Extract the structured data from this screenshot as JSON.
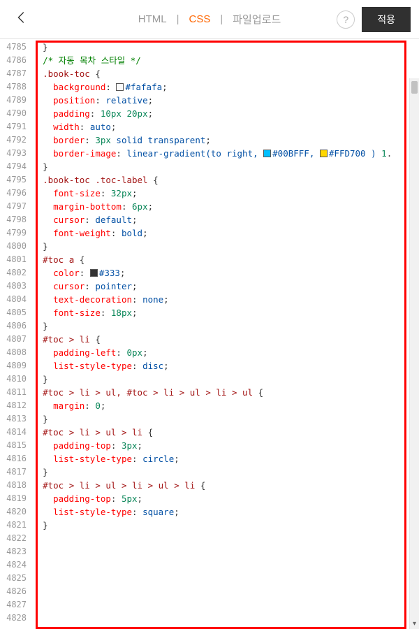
{
  "header": {
    "tabs": {
      "html": "HTML",
      "css": "CSS",
      "upload": "파일업로드"
    },
    "help": "?",
    "apply": "적용"
  },
  "gutterStart": 4785,
  "gutterEnd": 4828,
  "swatches": {
    "fafafa": "#fafafa",
    "c00bfff": "#00BFFF",
    "cffd700": "#FFD700",
    "c333": "#333333"
  },
  "lines": [
    {
      "t": "raw",
      "txt": "  }"
    },
    {
      "t": "raw",
      "txt": ""
    },
    {
      "t": "comment",
      "pre": "  ",
      "txt": "/* 자동 목차 스타일 */"
    },
    {
      "t": "selopen",
      "pre": "  ",
      "sel": ".book-toc"
    },
    {
      "t": "decl",
      "pre": "    ",
      "prop": "background",
      "valParts": [
        {
          "sw": "fafafa"
        },
        {
          "txt": "#fafafa"
        }
      ]
    },
    {
      "t": "decl",
      "pre": "    ",
      "prop": "position",
      "valParts": [
        {
          "txt": "relative"
        }
      ]
    },
    {
      "t": "decl",
      "pre": "    ",
      "prop": "padding",
      "valParts": [
        {
          "num": "10px"
        },
        {
          "txt": " "
        },
        {
          "num": "20px"
        }
      ]
    },
    {
      "t": "decl",
      "pre": "    ",
      "prop": "width",
      "valParts": [
        {
          "txt": "auto"
        }
      ]
    },
    {
      "t": "decl",
      "pre": "    ",
      "prop": "border",
      "valParts": [
        {
          "num": "3px"
        },
        {
          "txt": " solid transparent"
        }
      ]
    },
    {
      "t": "decl",
      "pre": "    ",
      "prop": "border-image",
      "valParts": [
        {
          "txt": "linear-gradient(to right, "
        },
        {
          "sw": "c00bfff"
        },
        {
          "txt": "#00BFFF, "
        },
        {
          "sw": "cffd700"
        },
        {
          "txt": "#FFD700 ) "
        },
        {
          "num": "1"
        }
      ],
      "noSemi": true,
      "trailDot": true
    },
    {
      "t": "close",
      "pre": "  "
    },
    {
      "t": "raw",
      "txt": ""
    },
    {
      "t": "selopen",
      "pre": "  ",
      "sel": ".book-toc .toc-label"
    },
    {
      "t": "decl",
      "pre": "    ",
      "prop": "font-size",
      "valParts": [
        {
          "num": "32px"
        }
      ]
    },
    {
      "t": "decl",
      "pre": "    ",
      "prop": "margin-bottom",
      "valParts": [
        {
          "num": "6px"
        }
      ]
    },
    {
      "t": "decl",
      "pre": "    ",
      "prop": "cursor",
      "valParts": [
        {
          "txt": "default"
        }
      ]
    },
    {
      "t": "decl",
      "pre": "    ",
      "prop": "font-weight",
      "valParts": [
        {
          "txt": "bold"
        }
      ]
    },
    {
      "t": "close",
      "pre": "  "
    },
    {
      "t": "raw",
      "txt": ""
    },
    {
      "t": "selopen",
      "pre": "  ",
      "sel": "#toc a"
    },
    {
      "t": "decl",
      "pre": "    ",
      "prop": "color",
      "valParts": [
        {
          "sw": "c333"
        },
        {
          "txt": "#333"
        }
      ]
    },
    {
      "t": "decl",
      "pre": "    ",
      "prop": "cursor",
      "valParts": [
        {
          "txt": "pointer"
        }
      ]
    },
    {
      "t": "decl",
      "pre": "    ",
      "prop": "text-decoration",
      "valParts": [
        {
          "txt": "none"
        }
      ]
    },
    {
      "t": "decl",
      "pre": "    ",
      "prop": "font-size",
      "valParts": [
        {
          "num": "18px"
        }
      ]
    },
    {
      "t": "close",
      "pre": "  "
    },
    {
      "t": "raw",
      "txt": ""
    },
    {
      "t": "selopen",
      "pre": "  ",
      "sel": "#toc > li"
    },
    {
      "t": "decl",
      "pre": "    ",
      "prop": "padding-left",
      "valParts": [
        {
          "num": "0px"
        }
      ]
    },
    {
      "t": "decl",
      "pre": "    ",
      "prop": "list-style-type",
      "valParts": [
        {
          "txt": "disc"
        }
      ]
    },
    {
      "t": "close",
      "pre": "  "
    },
    {
      "t": "raw",
      "txt": ""
    },
    {
      "t": "selopen",
      "pre": "  ",
      "sel": "#toc > li > ul, #toc > li > ul > li > ul"
    },
    {
      "t": "decl",
      "pre": "    ",
      "prop": "margin",
      "valParts": [
        {
          "num": "0"
        }
      ]
    },
    {
      "t": "close",
      "pre": "  "
    },
    {
      "t": "raw",
      "txt": ""
    },
    {
      "t": "selopen",
      "pre": "  ",
      "sel": "#toc > li > ul > li"
    },
    {
      "t": "decl",
      "pre": "    ",
      "prop": "padding-top",
      "valParts": [
        {
          "num": "3px"
        }
      ]
    },
    {
      "t": "decl",
      "pre": "    ",
      "prop": "list-style-type",
      "valParts": [
        {
          "txt": "circle"
        }
      ]
    },
    {
      "t": "close",
      "pre": "  "
    },
    {
      "t": "raw",
      "txt": ""
    },
    {
      "t": "selopen",
      "pre": "  ",
      "sel": "#toc > li > ul > li > ul > li"
    },
    {
      "t": "decl",
      "pre": "    ",
      "prop": "padding-top",
      "valParts": [
        {
          "num": "5px"
        }
      ]
    },
    {
      "t": "decl",
      "pre": "    ",
      "prop": "list-style-type",
      "valParts": [
        {
          "txt": "square"
        }
      ]
    },
    {
      "t": "close",
      "pre": "  "
    }
  ]
}
